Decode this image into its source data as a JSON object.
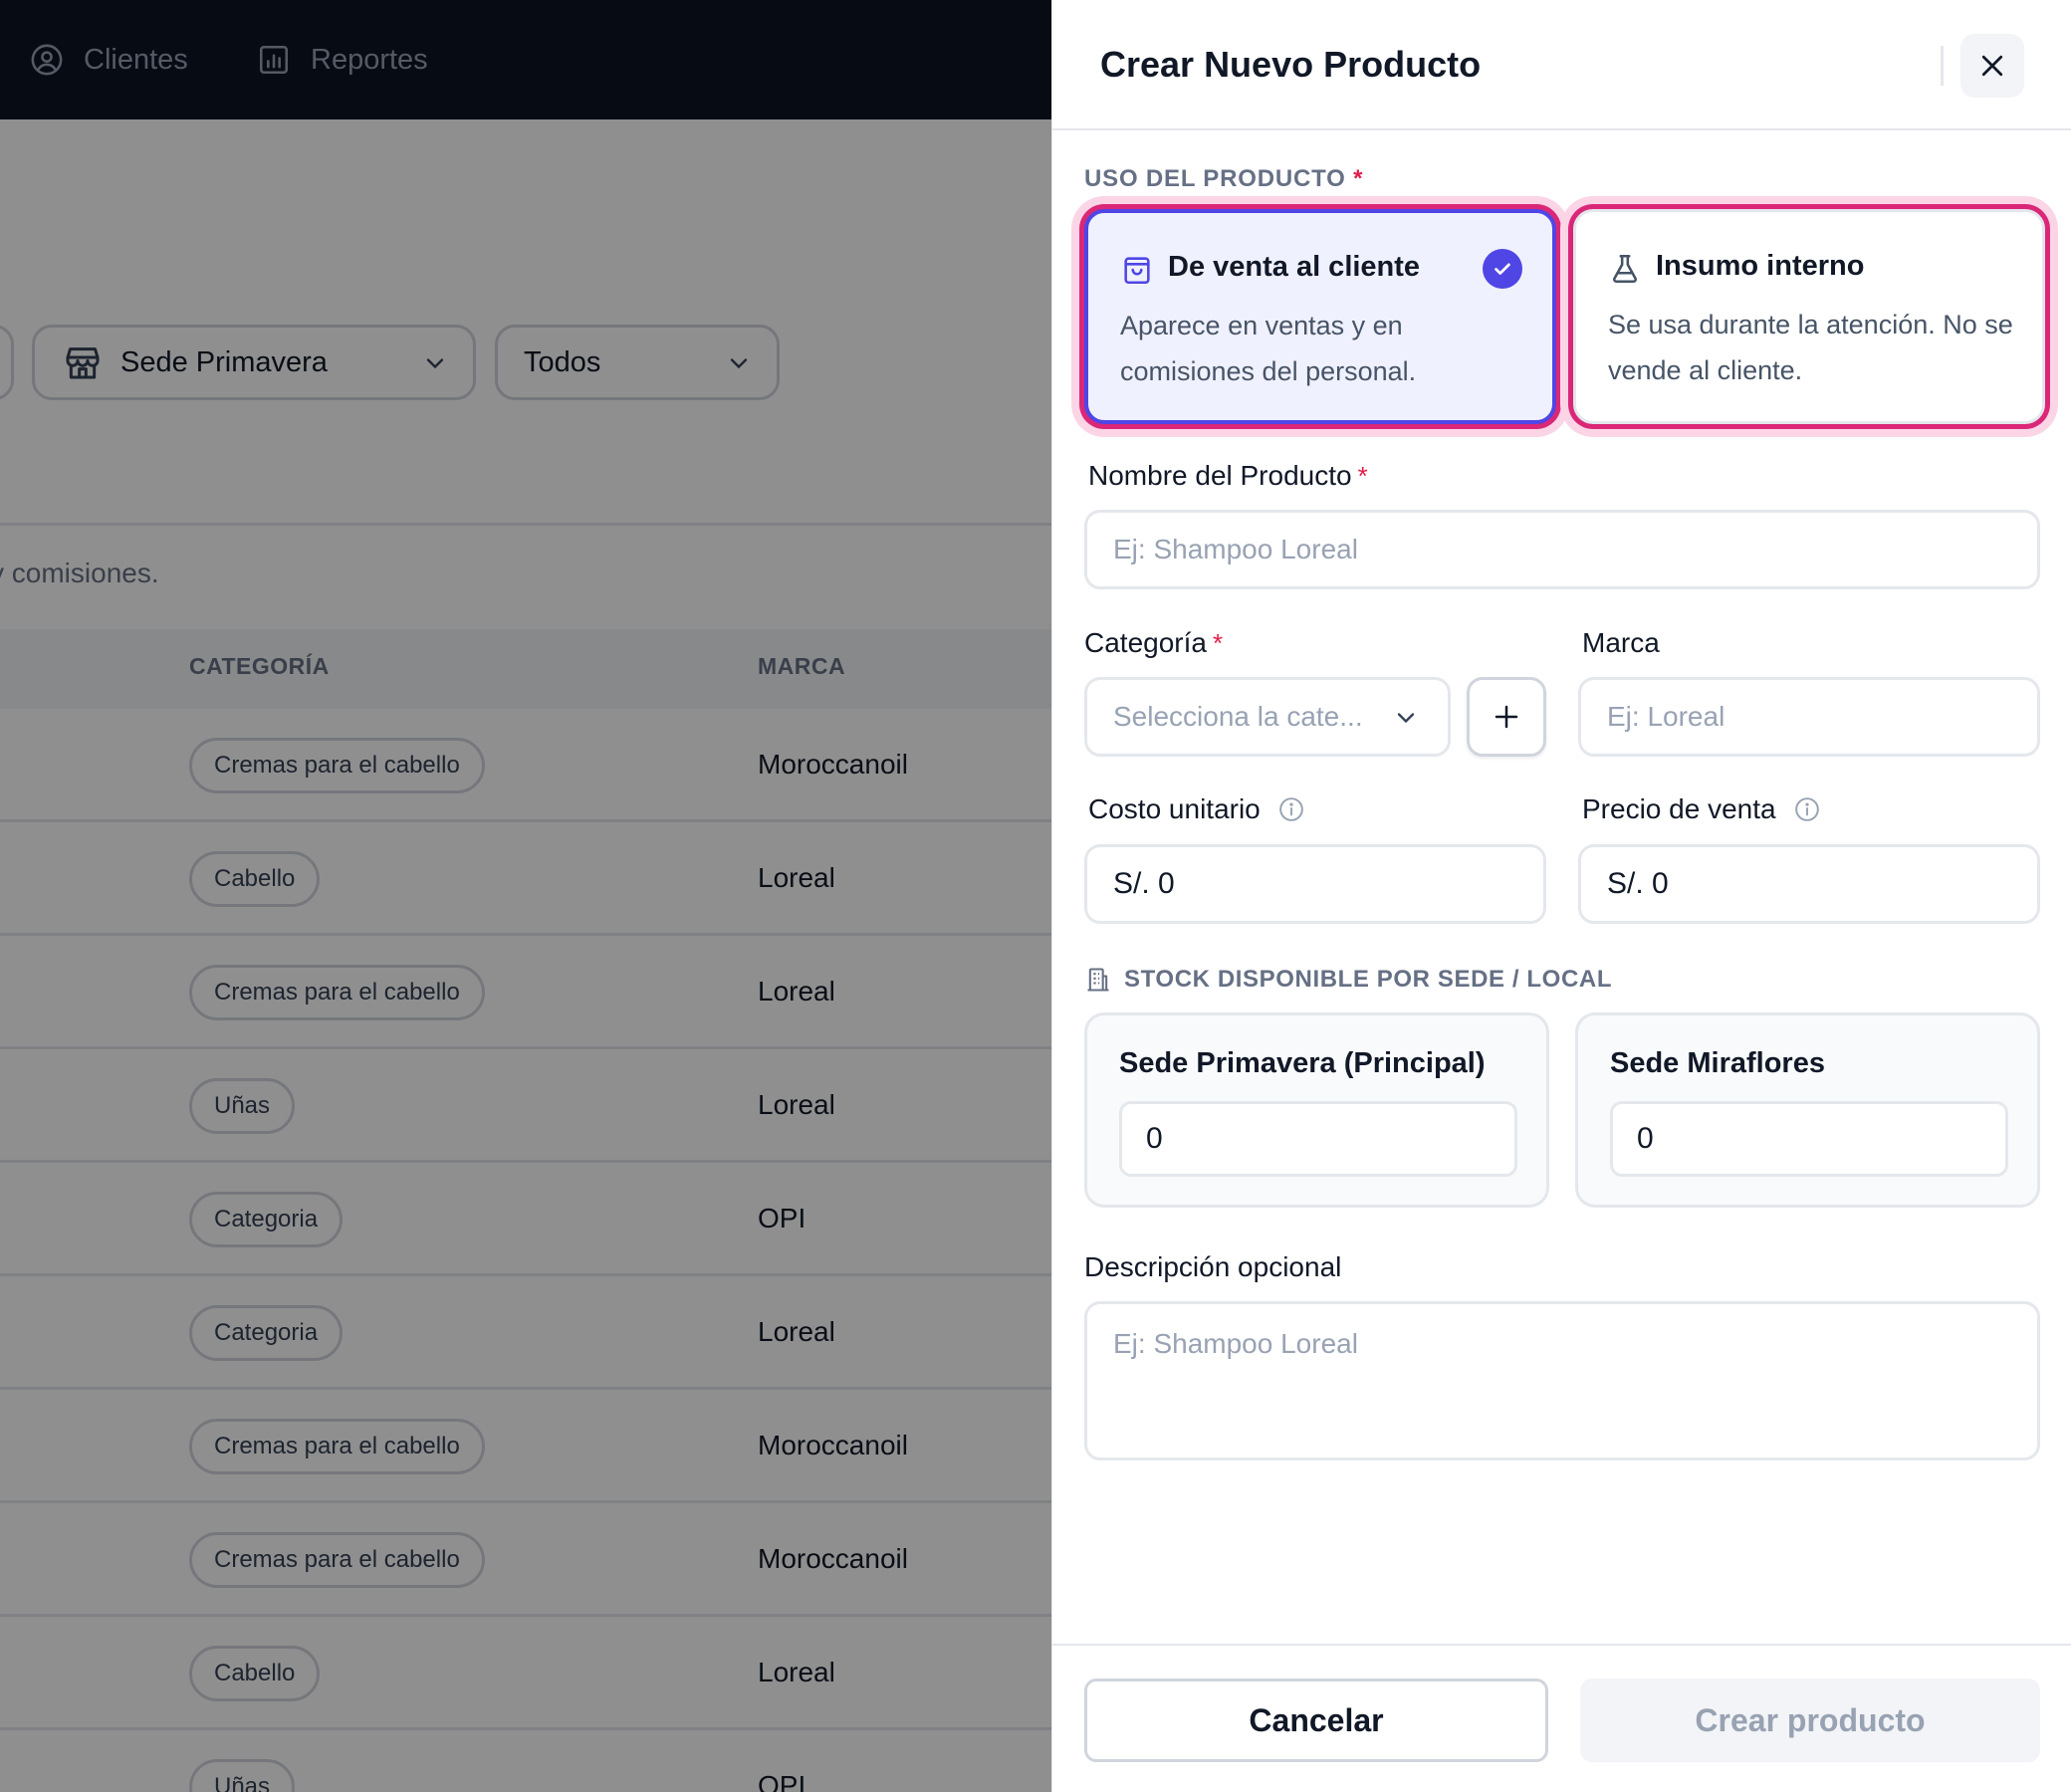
{
  "background": {
    "nav": [
      {
        "label": "Clientes",
        "icon": "user-circle-icon"
      },
      {
        "label": "Reportes",
        "icon": "bar-chart-icon"
      }
    ],
    "filters": {
      "location": "Sede Primavera",
      "status": "Todos"
    },
    "subtitle": "y comisiones.",
    "table": {
      "headers": [
        "CATEGORÍA",
        "MARCA"
      ],
      "rows": [
        {
          "category": "Cremas para el cabello",
          "brand": "Moroccanoil"
        },
        {
          "category": "Cabello",
          "brand": "Loreal"
        },
        {
          "category": "Cremas para el cabello",
          "brand": "Loreal"
        },
        {
          "category": "Uñas",
          "brand": "Loreal"
        },
        {
          "category": "Categoria",
          "brand": "OPI"
        },
        {
          "category": "Categoria",
          "brand": "Loreal"
        },
        {
          "category": "Cremas para el cabello",
          "brand": "Moroccanoil"
        },
        {
          "category": "Cremas para el cabello",
          "brand": "Moroccanoil"
        },
        {
          "category": "Cabello",
          "brand": "Loreal"
        },
        {
          "category": "Uñas",
          "brand": "OPI"
        }
      ]
    }
  },
  "drawer": {
    "title": "Crear Nuevo Producto",
    "usage": {
      "label": "USO DEL PRODUCTO",
      "required": "*",
      "options": [
        {
          "title": "De venta al cliente",
          "description": "Aparece en ventas y en comisiones del personal.",
          "selected": true,
          "icon": "shopping-bag-icon"
        },
        {
          "title": "Insumo interno",
          "description": "Se usa durante la atención. No se vende al cliente.",
          "selected": false,
          "icon": "flask-icon"
        }
      ]
    },
    "name": {
      "label": "Nombre del Producto",
      "required": "*",
      "placeholder": "Ej: Shampoo Loreal",
      "value": ""
    },
    "category": {
      "label": "Categoría",
      "required": "*",
      "placeholder": "Selecciona la cate..."
    },
    "brand": {
      "label": "Marca",
      "placeholder": "Ej: Loreal"
    },
    "unit_cost": {
      "label": "Costo unitario",
      "value": "S/. 0"
    },
    "sale_price": {
      "label": "Precio de venta",
      "value": "S/. 0"
    },
    "stock": {
      "label": "STOCK DISPONIBLE POR SEDE / LOCAL",
      "locations": [
        {
          "name": "Sede Primavera (Principal)",
          "value": "0"
        },
        {
          "name": "Sede Miraflores",
          "value": "0"
        }
      ]
    },
    "description": {
      "label": "Descripción opcional",
      "placeholder": "Ej: Shampoo Loreal"
    },
    "buttons": {
      "cancel": "Cancelar",
      "create": "Crear producto"
    }
  },
  "colors": {
    "primary": "#4f46e5",
    "highlight": "#db2777",
    "nav_bg": "#0c1424",
    "required": "#e11d48"
  }
}
